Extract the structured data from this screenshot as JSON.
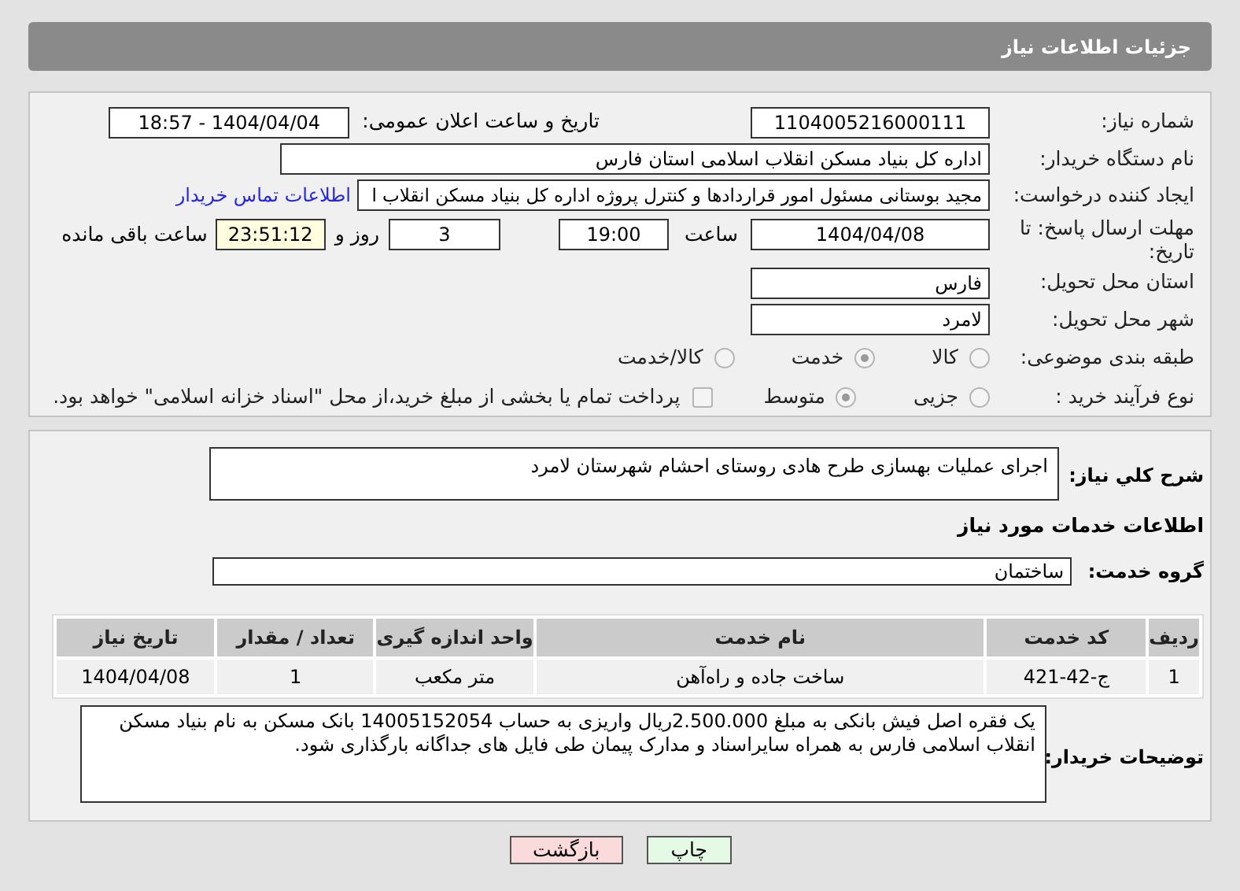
{
  "page_title": "جزئیات اطلاعات نیاز",
  "need_number": {
    "label": "شماره نیاز:",
    "value": "1104005216000111"
  },
  "announce": {
    "label": "تاریخ و ساعت اعلان عمومی:",
    "value": "1404/04/04 - 18:57"
  },
  "buyer": {
    "label": "نام دستگاه خریدار:",
    "value": "اداره کل بنیاد مسکن انقلاب اسلامی استان فارس"
  },
  "requester": {
    "label": "ایجاد کننده درخواست:",
    "value": "مجید بوستانی مسئول امور قراردادها و کنترل پروژه اداره کل بنیاد مسکن انقلاب ا",
    "link": "اطلاعات تماس خریدار"
  },
  "deadline": {
    "label": "مهلت ارسال پاسخ: تا تاریخ:",
    "date": "1404/04/08",
    "time_label": "ساعت",
    "time": "19:00",
    "days": "3",
    "days_label": "روز و",
    "remaining": "23:51:12",
    "remaining_label": "ساعت باقی مانده"
  },
  "province": {
    "label": "استان محل تحویل:",
    "value": "فارس"
  },
  "city": {
    "label": "شهر محل تحویل:",
    "value": "لامرد"
  },
  "category": {
    "label": "طبقه بندی موضوعی:",
    "options": [
      {
        "label": "کالا",
        "selected": false
      },
      {
        "label": "خدمت",
        "selected": true
      },
      {
        "label": "کالا/خدمت",
        "selected": false
      }
    ]
  },
  "process": {
    "label": "نوع فرآیند خرید :",
    "options": [
      {
        "label": "جزیی",
        "selected": false
      },
      {
        "label": "متوسط",
        "selected": true
      }
    ],
    "payment": {
      "label": "پرداخت تمام یا بخشی از مبلغ خرید،از محل \"اسناد خزانه اسلامی\" خواهد بود.",
      "checked": false
    }
  },
  "description": {
    "label": "شرح کلي نیاز:",
    "value": "اجرای عملیات بهسازی طرح هادی روستای احشام شهرستان لامرد"
  },
  "services_heading": "اطلاعات خدمات مورد نیاز",
  "service_group": {
    "label": "گروه خدمت:",
    "value": "ساختمان"
  },
  "table": {
    "columns": [
      "ردیف",
      "کد خدمت",
      "نام خدمت",
      "واحد اندازه گیری",
      "تعداد / مقدار",
      "تاریخ نیاز"
    ],
    "rows": [
      [
        "1",
        "ج-42-421",
        "ساخت جاده و راه‌آهن",
        "متر مکعب",
        "1",
        "1404/04/08"
      ]
    ]
  },
  "notes": {
    "label": "توضیحات خریدار:",
    "value": "یک فقره اصل فیش بانکی به مبلغ 2.500.000ریال واریزی به حساب 14005152054 بانک مسکن به نام بنیاد مسکن انقلاب اسلامی فارس به همراه سایراسناد و مدارک پیمان طی فایل های جداگانه بارگذاری شود."
  },
  "buttons": [
    {
      "label": "چاپ",
      "kind": "print"
    },
    {
      "label": "بازگشت",
      "kind": "back"
    }
  ]
}
